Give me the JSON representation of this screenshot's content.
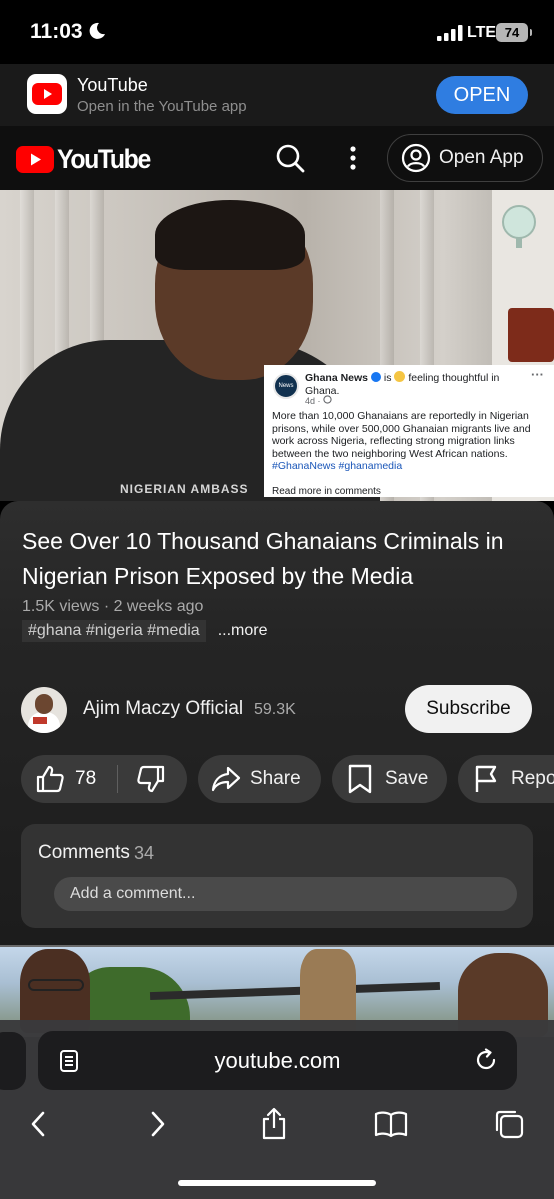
{
  "status": {
    "time": "11:03",
    "network": "LTE",
    "battery": "74"
  },
  "banner": {
    "title": "YouTube",
    "subtitle": "Open in the YouTube app",
    "open_label": "OPEN"
  },
  "header": {
    "logo_text": "YouTube",
    "open_app_label": "Open App"
  },
  "video": {
    "shirt_text": "NIGERIAN AMBASS",
    "overlay": {
      "page_name": "Ghana News",
      "avatar_text": "News",
      "activity_prefix": "is",
      "activity": "feeling thoughtful in Ghana.",
      "time": "4d · ",
      "body": "More than 10,000 Ghanaians are reportedly in Nigerian prisons, while over 500,000 Ghanaian migrants live and work across Nigeria, reflecting strong migration links between the two neighboring West African nations.",
      "hashtags": "#GhanaNews #ghanamedia",
      "read_more": "Read more in comments",
      "menu": "···"
    }
  },
  "info": {
    "title": "See Over 10 Thousand Ghanaians Criminals in Nigerian Prison Exposed by the Media",
    "meta": "1.5K views · 2 weeks ago",
    "hashtags": "#ghana #nigeria #media",
    "more": "...more"
  },
  "channel": {
    "name": "Ajim Maczy Official",
    "subscribers": "59.3K",
    "subscribe_label": "Subscribe"
  },
  "actions": {
    "likes": "78",
    "share": "Share",
    "save": "Save",
    "report": "Report"
  },
  "comments": {
    "label": "Comments",
    "count": "34",
    "placeholder": "Add a comment..."
  },
  "browser": {
    "url": "youtube.com"
  }
}
